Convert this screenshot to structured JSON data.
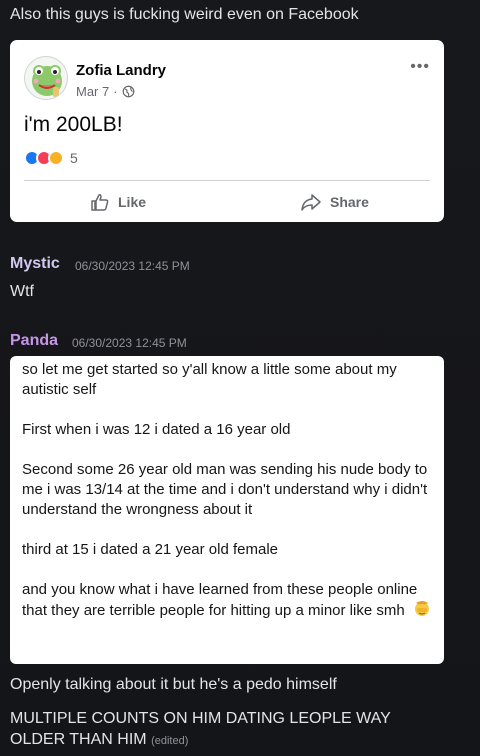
{
  "intro_text": "Also this guys is fucking weird even on Facebook",
  "fb_post": {
    "author": "Zofia Landry",
    "date": "Mar 7",
    "separator": "·",
    "content": "i'm 200LB!",
    "reaction_count": "5",
    "like_label": "Like",
    "share_label": "Share",
    "more_label": "•••"
  },
  "messages": [
    {
      "author": "Mystic",
      "author_color": "#d3c8f0",
      "timestamp": "06/30/2023 12:45 PM",
      "text": "Wtf"
    },
    {
      "author": "Panda",
      "author_color": "#c596e6",
      "timestamp": "06/30/2023 12:45 PM",
      "quote_paragraphs": [
        "so let me get started so y'all know a little some about my autistic self",
        "First when i was 12 i dated a 16 year old",
        "Second some 26 year old man was sending his nude body to me i was 13/14 at the time and i don't understand why i didn't understand the wrongness about it",
        "third at 15 i dated a 21 year old female",
        "and you know what i have learned from these people online that they are  terrible people for hitting up a minor like smh"
      ],
      "followups": [
        "Openly talking about it but he's a pedo himself",
        "MULTIPLE COUNTS ON HIM DATING LEOPLE WAY OLDER THAN HIM"
      ],
      "edited_label": "(edited)"
    }
  ],
  "colors": {
    "background": "#16171b",
    "facebook_blue": "#1877f2",
    "love_red": "#f33e58",
    "care_yellow": "#f7b125"
  }
}
